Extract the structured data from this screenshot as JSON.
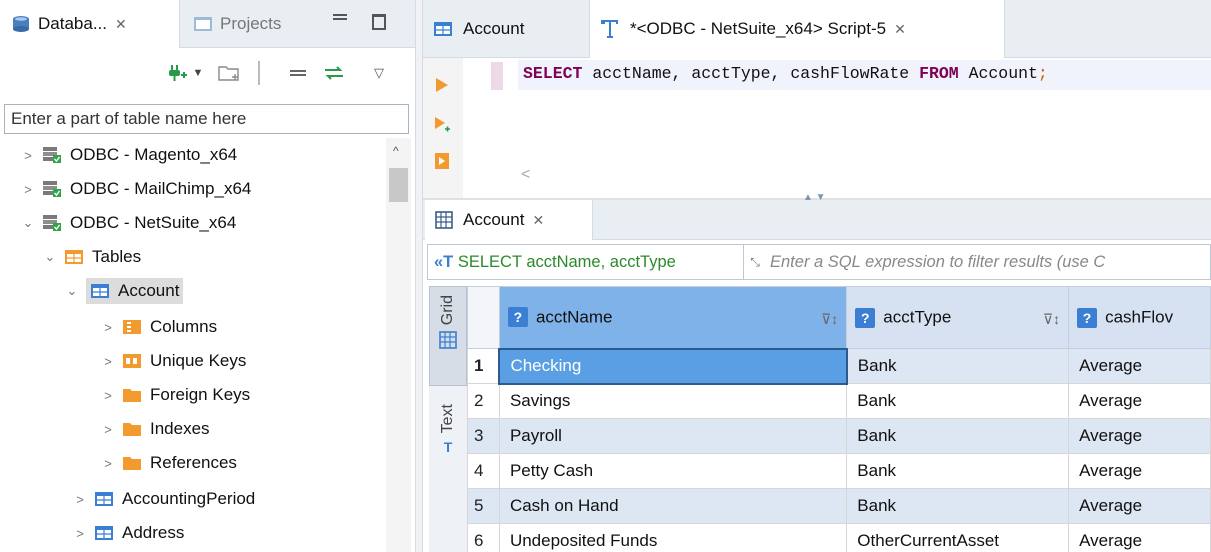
{
  "left_panel": {
    "tabs": [
      {
        "label": "Databa...",
        "close": "✕"
      },
      {
        "label": "Projects"
      }
    ],
    "search": {
      "placeholder": "Enter a part of table name here"
    },
    "tree": [
      {
        "label": "ODBC - Magento_x64",
        "level": 0,
        "expanded": false,
        "icon": "database-connection-icon"
      },
      {
        "label": "ODBC - MailChimp_x64",
        "level": 0,
        "expanded": false,
        "icon": "database-connection-icon"
      },
      {
        "label": "ODBC - NetSuite_x64",
        "level": 0,
        "expanded": true,
        "icon": "database-connection-icon"
      },
      {
        "label": "Tables",
        "level": 1,
        "expanded": true,
        "icon": "tables-folder-icon"
      },
      {
        "label": "Account",
        "level": 2,
        "expanded": true,
        "selected": true,
        "icon": "table-icon"
      },
      {
        "label": "Columns",
        "level": 3,
        "expanded": false,
        "icon": "columns-folder-icon"
      },
      {
        "label": "Unique Keys",
        "level": 3,
        "expanded": false,
        "icon": "keys-folder-icon"
      },
      {
        "label": "Foreign Keys",
        "level": 3,
        "expanded": false,
        "icon": "folder-icon"
      },
      {
        "label": "Indexes",
        "level": 3,
        "expanded": false,
        "icon": "folder-icon"
      },
      {
        "label": "References",
        "level": 3,
        "expanded": false,
        "icon": "folder-icon"
      },
      {
        "label": "AccountingPeriod",
        "level": 2,
        "expanded": false,
        "icon": "table-icon"
      },
      {
        "label": "Address",
        "level": 2,
        "expanded": false,
        "icon": "table-icon"
      }
    ]
  },
  "editor": {
    "tabs": [
      {
        "label": "Account"
      },
      {
        "label": "*<ODBC - NetSuite_x64> Script-5",
        "close": "✕"
      }
    ],
    "sql": {
      "kw_select": "SELECT",
      "cols": " acctName, acctType, cashFlowRate ",
      "kw_from": "FROM",
      "table": " Account",
      "semi": ";"
    },
    "hscroll_arrow": "<"
  },
  "results": {
    "tab_label": "Account",
    "tab_close": "✕",
    "filter_sql": "SELECT acctName, acctType",
    "filter_placeholder": "Enter a SQL expression to filter results (use C",
    "side_tabs": {
      "grid": "Grid",
      "text": "Text"
    },
    "columns": [
      "acctName",
      "acctType",
      "cashFlov"
    ],
    "rows": [
      {
        "n": "1",
        "acctName": "Checking",
        "acctType": "Bank",
        "cashFlowRate": "Average"
      },
      {
        "n": "2",
        "acctName": "Savings",
        "acctType": "Bank",
        "cashFlowRate": "Average"
      },
      {
        "n": "3",
        "acctName": "Payroll",
        "acctType": "Bank",
        "cashFlowRate": "Average"
      },
      {
        "n": "4",
        "acctName": "Petty Cash",
        "acctType": "Bank",
        "cashFlowRate": "Average"
      },
      {
        "n": "5",
        "acctName": "Cash on Hand",
        "acctType": "Bank",
        "cashFlowRate": "Average"
      },
      {
        "n": "6",
        "acctName": "Undeposited Funds",
        "acctType": "OtherCurrentAsset",
        "cashFlowRate": "Average"
      }
    ]
  },
  "colors": {
    "header_bg": "#d6e2f2",
    "selected_header": "#7fb2e8",
    "selected_cell": "#5a9fe3",
    "row_stripe": "#dde6f3",
    "keyword": "#7f0055"
  }
}
